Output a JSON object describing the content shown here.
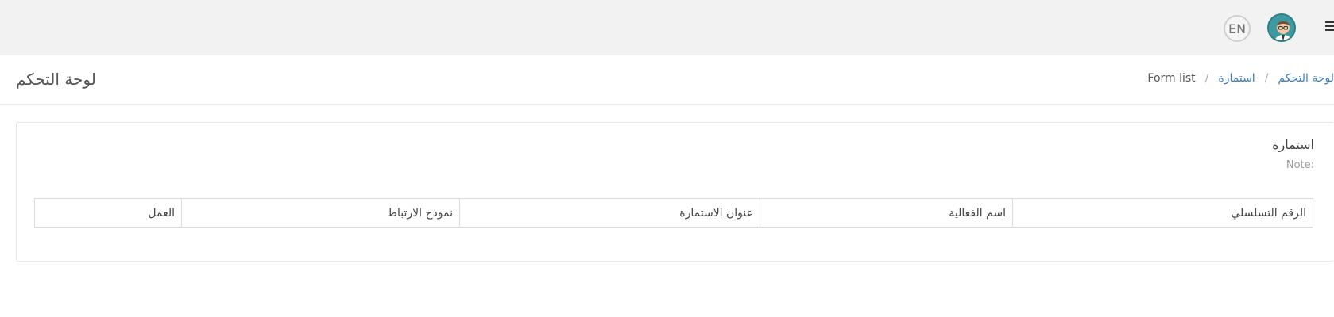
{
  "header": {
    "lang_label": "EN",
    "avatar_icon": "user-avatar",
    "menu_icon": "hamburger-menu"
  },
  "page": {
    "title": "لوحة التحكم",
    "breadcrumb": [
      {
        "label": "لوحة التحكم"
      },
      {
        "label": "استمارة"
      },
      {
        "label": "Form list"
      }
    ]
  },
  "card": {
    "title": "استمارة",
    "note": "Note:",
    "table": {
      "columns": [
        "الرقم التسلسلي",
        "اسم الفعالية",
        "عنوان الاستمارة",
        "نموذج الارتباط",
        "العمل"
      ]
    }
  },
  "colors": {
    "topbar_bg": "#f2f2f2",
    "link": "#3a7fc1",
    "avatar_bg": "#3e9aa0"
  }
}
